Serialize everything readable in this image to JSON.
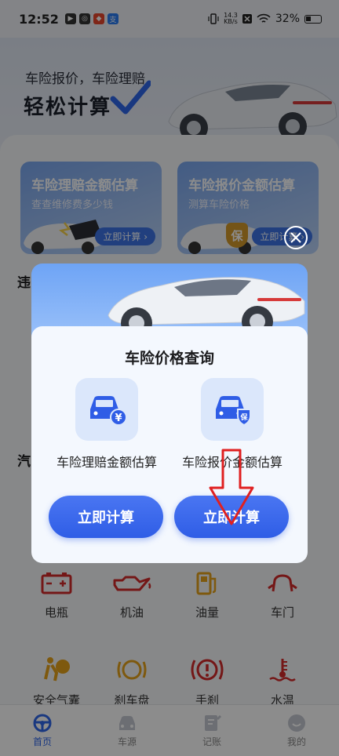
{
  "status_bar": {
    "time": "12:52",
    "net_speed_value": "14.3",
    "net_speed_unit": "KB/s",
    "battery": "32%"
  },
  "hero": {
    "subtitle": "车险报价，车险理赔",
    "title": "轻松计算"
  },
  "feature_cards": [
    {
      "title": "车险理赔金额估算",
      "subtitle": "查查维修费多少钱",
      "button": "立即计算"
    },
    {
      "title": "车险报价金额估算",
      "subtitle": "测算车险价格",
      "button": "立即计算"
    }
  ],
  "section_labels": [
    "违",
    "汽"
  ],
  "grid_row1": [
    "电瓶",
    "机油",
    "油量",
    "车门"
  ],
  "grid_row2": [
    "安全气囊",
    "刹车盘",
    "手刹",
    "水温"
  ],
  "tabs": [
    {
      "label": "首页",
      "icon": "steering-wheel-icon",
      "active": true
    },
    {
      "label": "车源",
      "icon": "car-icon",
      "active": false
    },
    {
      "label": "记账",
      "icon": "notebook-icon",
      "active": false
    },
    {
      "label": "我的",
      "icon": "smile-icon",
      "active": false
    }
  ],
  "modal": {
    "title": "车险价格查询",
    "options": [
      {
        "label": "车险理赔金额估算",
        "button": "立即计算",
        "icon": "car-yuan-icon"
      },
      {
        "label": "车险报价金额估算",
        "button": "立即计算",
        "icon": "car-insurance-icon"
      }
    ],
    "close_icon": "close-icon",
    "insurance_badge": "保",
    "yuan_badge": "¥",
    "bao_badge": "保"
  },
  "colors": {
    "accent": "#2f5de6",
    "annotation": "#e02020",
    "warning_red": "#d42a2a",
    "warning_yellow": "#e6a21a"
  }
}
